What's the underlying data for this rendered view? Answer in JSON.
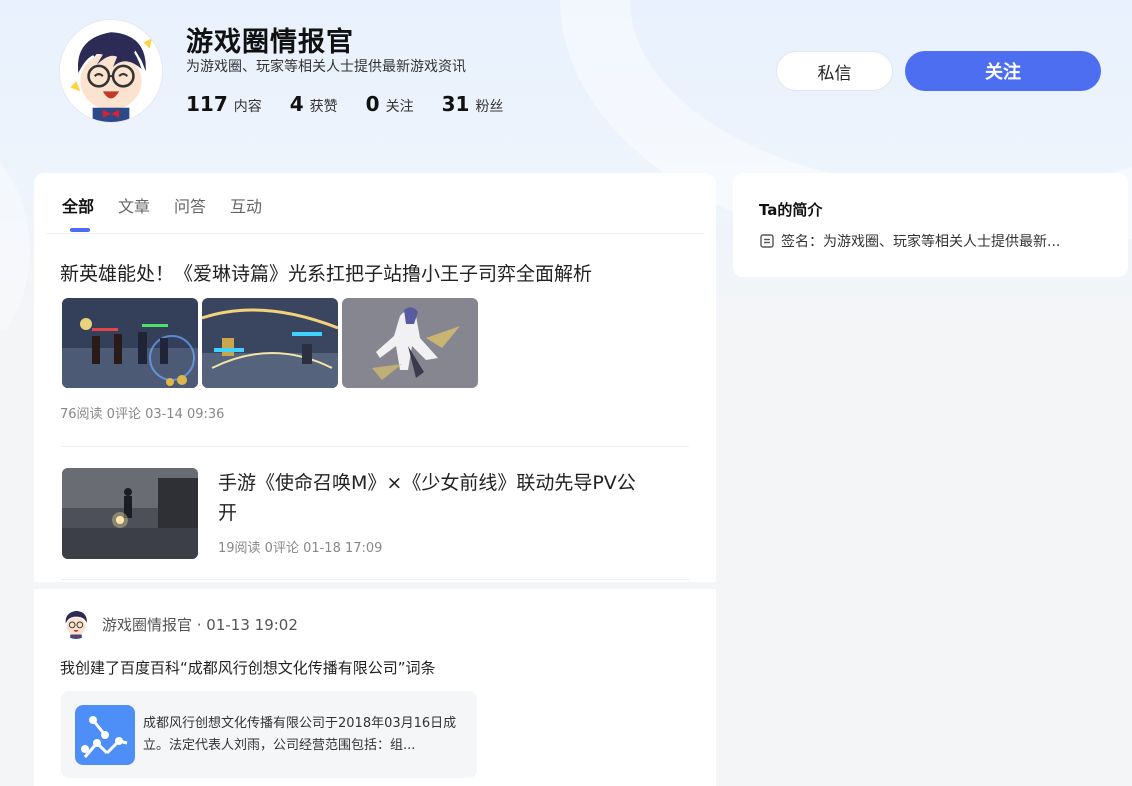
{
  "profile": {
    "name": "游戏圈情报官",
    "description": "为游戏圈、玩家等相关人士提供最新游戏资讯",
    "avatar_icon": "cartoon-boy-avatar-icon",
    "stats": [
      {
        "num": "117",
        "label": "内容"
      },
      {
        "num": "4",
        "label": "获赞"
      },
      {
        "num": "0",
        "label": "关注"
      },
      {
        "num": "31",
        "label": "粉丝"
      }
    ],
    "message_label": "私信",
    "follow_label": "关注"
  },
  "tabs": [
    {
      "label": "全部",
      "active": true
    },
    {
      "label": "文章",
      "active": false
    },
    {
      "label": "问答",
      "active": false
    },
    {
      "label": "互动",
      "active": false
    }
  ],
  "articles": [
    {
      "title": "新英雄能处！《爱琳诗篇》光系扛把子站撸小王子司弈全面解析",
      "meta": "76阅读  0评论  03-14 09:36"
    },
    {
      "title": "手游《使命召唤M》×《少女前线》联动先导PV公开",
      "meta": "19阅读  0评论  01-18 17:09"
    }
  ],
  "activity": {
    "author_line": "游戏圈情报官 · 01-13 19:02",
    "text": "我创建了百度百科“成都风行创想文化传播有限公司”词条",
    "link_icon": "baike-network-icon",
    "link_text": "成都风行创想文化传播有限公司于2018年03月16日成立。法定代表人刘雨，公司经营范围包括：组..."
  },
  "side": {
    "title": "Ta的简介",
    "sign_icon": "document-icon",
    "sign_text": "签名：为游戏圈、玩家等相关人士提供最新..."
  },
  "colors": {
    "accent": "#4e6ef2",
    "link_icon_bg": "#4e8ef7"
  }
}
